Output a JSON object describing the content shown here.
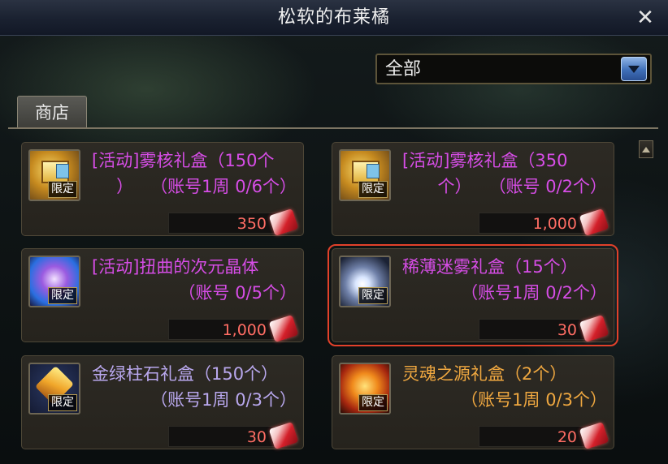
{
  "window": {
    "title": "松软的布莱橘"
  },
  "filter": {
    "selected": "全部"
  },
  "tabs": [
    {
      "label": "商店"
    }
  ],
  "items": [
    {
      "name_line1": "[活动]雾核礼盒（150个",
      "name_line2": "）　　（账号1周 0/6个）",
      "tag": "限定",
      "price": "350",
      "color": "#d64de6",
      "icon": "gold-gift-box-icon",
      "selected": false
    },
    {
      "name_line1": "[活动]雾核礼盒（350",
      "name_line2": "个）　　（账号 0/2个）",
      "tag": "限定",
      "price": "1,000",
      "color": "#d64de6",
      "icon": "gold-gift-box-icon",
      "selected": false
    },
    {
      "name_line1": "[活动]扭曲的次元晶体",
      "name_line2": "（账号 0/5个）",
      "tag": "限定",
      "price": "1,000",
      "color": "#d64de6",
      "icon": "dimension-crystal-icon",
      "selected": false
    },
    {
      "name_line1": "稀薄迷雾礼盒（15个）",
      "name_line2": "（账号1周 0/2个）",
      "tag": "限定",
      "price": "30",
      "color": "#d64de6",
      "icon": "mist-orb-icon",
      "selected": true
    },
    {
      "name_line1": "金绿柱石礼盒（150个）",
      "name_line2": "（账号1周 0/3个）",
      "tag": "限定",
      "price": "30",
      "color": "#b9a8ee",
      "icon": "chrysoberyl-gem-icon",
      "selected": false
    },
    {
      "name_line1": "灵魂之源礼盒（2个）",
      "name_line2": "（账号1周 0/3个）",
      "tag": "限定",
      "price": "20",
      "color": "#f0a840",
      "icon": "soul-source-sun-icon",
      "selected": false
    }
  ]
}
